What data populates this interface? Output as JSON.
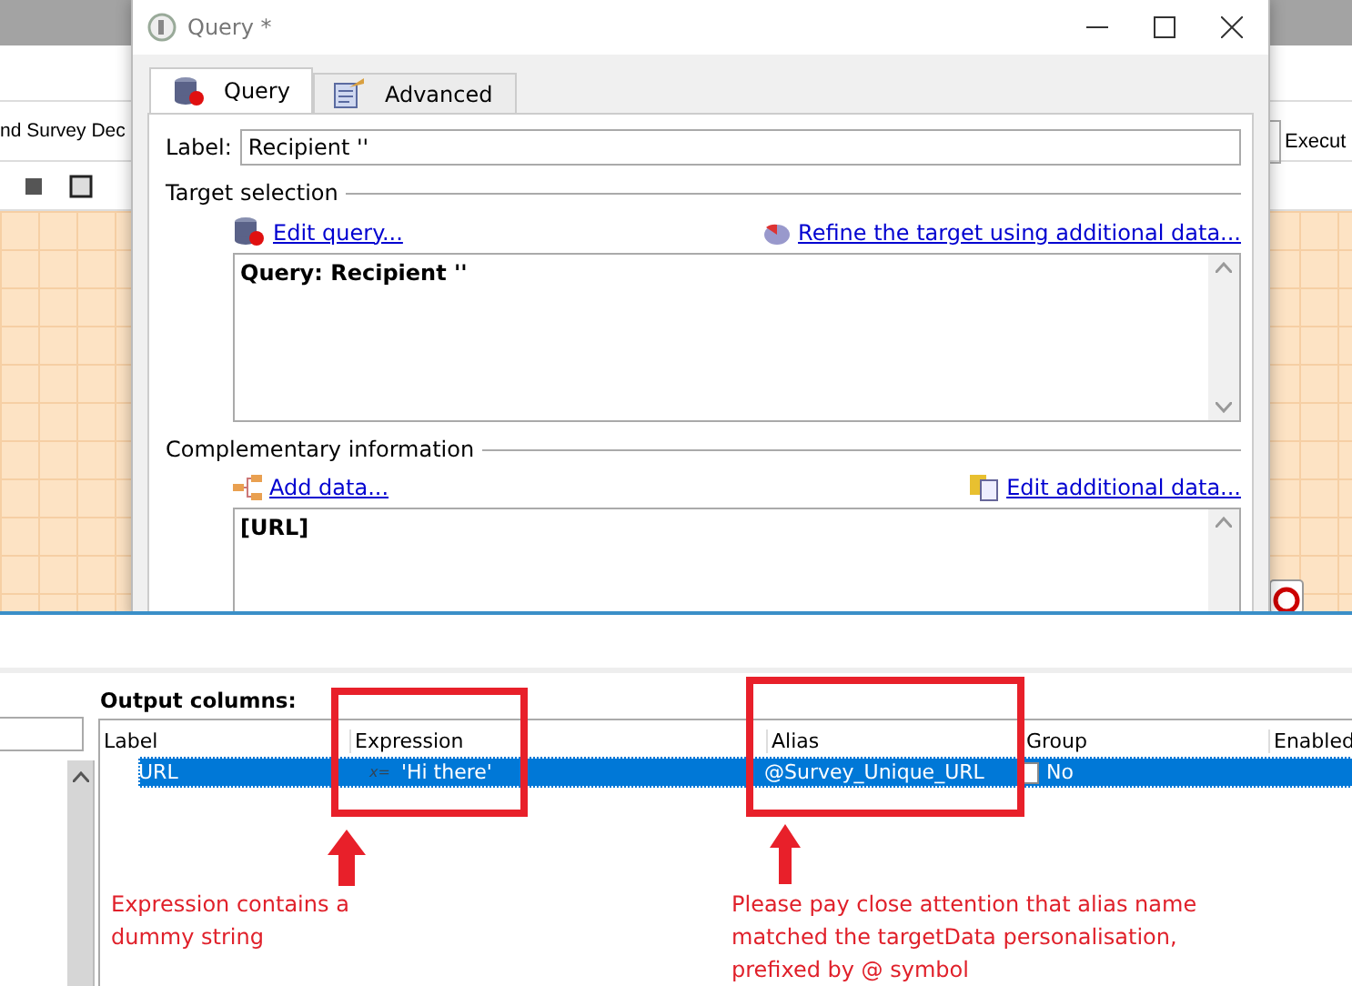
{
  "background_app": {
    "title_fragment": "nd Survey Dec",
    "execute_fragment": "Execut"
  },
  "dialog": {
    "title": "Query *",
    "tabs": [
      {
        "label": "Query",
        "selected": true
      },
      {
        "label": "Advanced",
        "selected": false
      }
    ],
    "label_field": {
      "label": "Label:",
      "value": "Recipient ''"
    },
    "target_selection": {
      "heading": "Target selection",
      "edit_link": "Edit query...",
      "refine_link": "Refine the target using additional data...",
      "query_text": "Query: Recipient ''"
    },
    "complementary": {
      "heading": "Complementary information",
      "add_link": "Add data...",
      "edit_link": "Edit additional data...",
      "content": "[URL]"
    }
  },
  "output_columns": {
    "title": "Output columns:",
    "columns": [
      "Label",
      "Expression",
      "Alias",
      "Group",
      "Enabled"
    ],
    "rows": [
      {
        "label": "URL",
        "expression_icon": "x=",
        "expression": "'Hi there'",
        "alias": "@Survey_Unique_URL",
        "group": "No",
        "group_checked": false,
        "selected": true
      }
    ]
  },
  "annotations": [
    {
      "text": "Expression contains a dummy string"
    },
    {
      "text": "Please pay close attention that alias name matched the targetData personalisation, prefixed by @ symbol"
    }
  ]
}
